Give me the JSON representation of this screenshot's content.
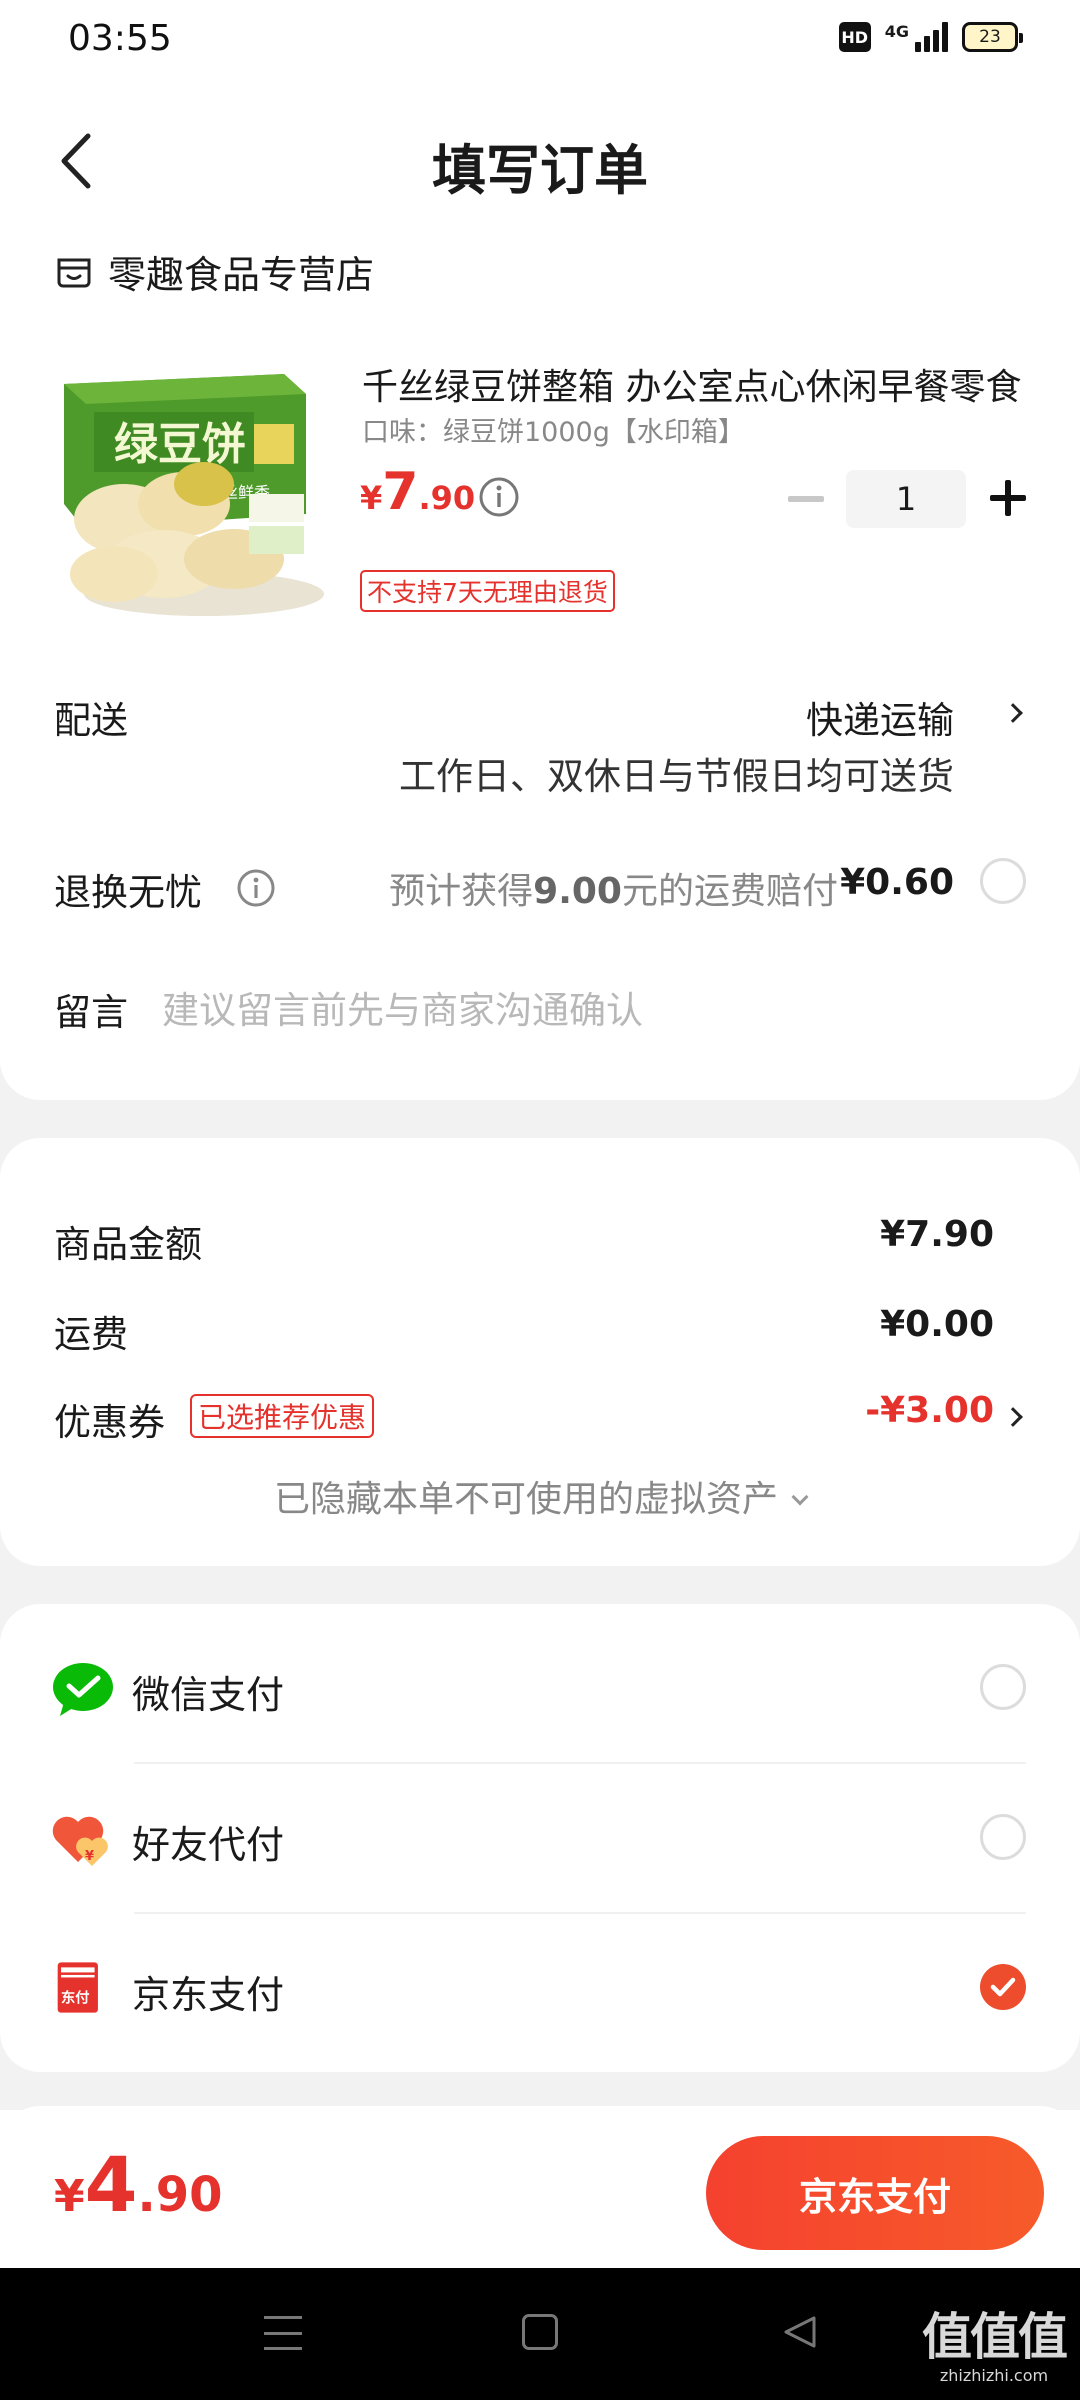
{
  "status_bar": {
    "time": "03:55",
    "hd": "HD",
    "network": "4G",
    "battery": "23"
  },
  "header": {
    "title": "填写订单"
  },
  "store": {
    "name": "零趣食品专营店"
  },
  "product": {
    "title": "千丝绿豆饼整箱 办公室点心休闲早餐零食",
    "spec": "口味：绿豆饼1000g【水印箱】",
    "price_currency": "¥",
    "price_int": "7",
    "price_dec": ".90",
    "quantity": "1",
    "return_policy": "不支持7天无理由退货",
    "image_text": "绿豆饼",
    "image_sub": "千丝鲜香"
  },
  "delivery": {
    "label": "配送",
    "method": "快递运输",
    "note": "工作日、双休日与节假日均可送货"
  },
  "return_worry_free": {
    "label": "退换无忧",
    "desc_prefix": "预计获得",
    "desc_amount": "9.00",
    "desc_suffix": "元的运费赔付",
    "price": "¥0.60",
    "checked": false
  },
  "message": {
    "label": "留言",
    "placeholder": "建议留言前先与商家沟通确认"
  },
  "summary": {
    "goods_label": "商品金额",
    "goods_value": "¥7.90",
    "shipping_label": "运费",
    "shipping_value": "¥0.00",
    "coupon_label": "优惠券",
    "coupon_tag": "已选推荐优惠",
    "coupon_value": "-¥3.00",
    "hidden_assets": "已隐藏本单不可使用的虚拟资产"
  },
  "payment": {
    "options": [
      {
        "label": "微信支付",
        "icon": "wechat-pay-icon",
        "selected": false
      },
      {
        "label": "好友代付",
        "icon": "friend-pay-icon",
        "selected": false
      },
      {
        "label": "京东支付",
        "icon": "jd-pay-icon",
        "icon_text": "东付",
        "selected": true
      }
    ]
  },
  "bottom": {
    "total_currency": "¥",
    "total_int": "4",
    "total_dec": ".90",
    "pay_button": "京东支付"
  },
  "watermark": {
    "big": "值值值",
    "small": "zhizhizhi.com"
  },
  "colors": {
    "accent": "#e5322d",
    "button": "#f5412f",
    "wechat": "#09bb07"
  }
}
